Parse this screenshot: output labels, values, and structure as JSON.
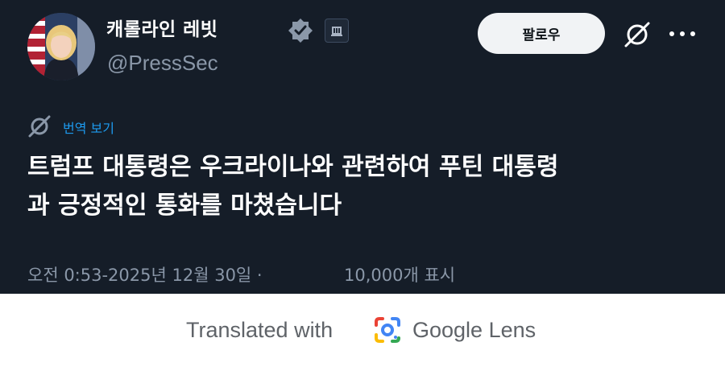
{
  "profile": {
    "display_name": "캐롤라인 레빗",
    "handle": "@PressSec",
    "avatar_icon": "profile-photo"
  },
  "header": {
    "follow_label": "팔로우"
  },
  "tweet": {
    "translate_label": "번역 보기",
    "text_lines": [
      "트럼프 대통령은 우크라이나와 관련하여 푸틴 대통령",
      "과 긍정적인 통화를 마쳤습니다"
    ],
    "timestamp": "오전 0:53-2025년 12월 30일 ·",
    "views": "10,000개 표시"
  },
  "footer": {
    "translated_with": "Translated with",
    "brand": "Google Lens"
  },
  "colors": {
    "background": "#151d28",
    "text": "#ffffff",
    "muted": "#8a97a8",
    "link": "#1d9bf0",
    "follow_bg": "#f1f3f5"
  }
}
